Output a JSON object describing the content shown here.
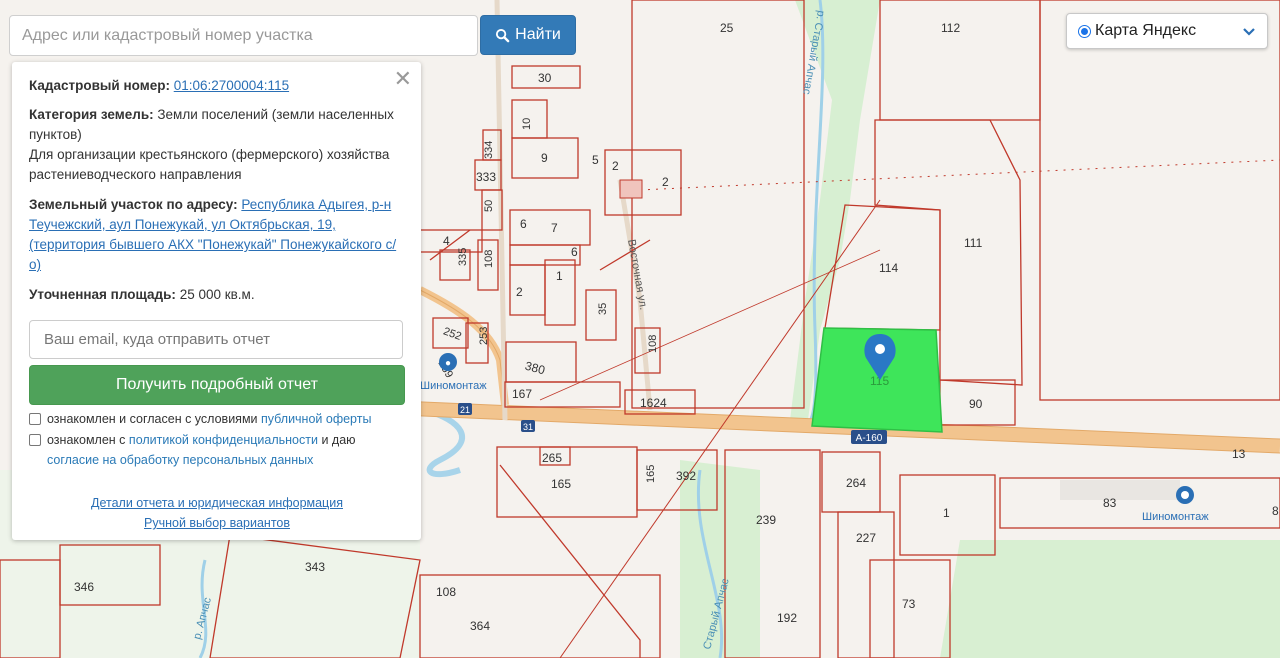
{
  "search": {
    "placeholder": "Адрес или кадастровый номер участка",
    "button_label": "Найти"
  },
  "map_type": {
    "selected": "Карта Яндекс"
  },
  "info": {
    "cadastral_label": "Кадастровый номер:",
    "cadastral_value": "01:06:2700004:115",
    "category_label": "Категория земель:",
    "category_value": "Земли поселений (земли населенных пунктов)",
    "usage_value": "Для организации крестьянского (фермерского) хозяйства растениеводческого направления",
    "address_label": "Земельный участок по адресу:",
    "address_value": "Республика Адыгея, р-н Теучежский, аул Понежукай, ул Октябрьская, 19, (территория бывшего АКХ \"Понежукай\" Понежукайского с/о)",
    "area_label": "Уточненная площадь:",
    "area_value": "25 000 кв.м.",
    "email_placeholder": "Ваш email, куда отправить отчет",
    "get_report_button": "Получить подробный отчет",
    "consent1_text": "ознакомлен и согласен с условиями",
    "consent1_link": "публичной оферты",
    "consent2_text": "ознакомлен с",
    "consent2_link": "политикой конфиденциальности",
    "consent2_text2": "и даю",
    "consent2_link2": "согласие на обработку персональных данных",
    "details_link": "Детали отчета и юридическая информация",
    "manual_link": "Ручной выбор вариантов"
  },
  "map": {
    "road_label": "А-160",
    "route_31": "31",
    "route_21": "21",
    "poi_tire_left": "Шиномонтаж",
    "poi_tire_right": "Шиномонтаж",
    "street_vostochnaya": "Восточная ул.",
    "river_old": "р. Старый Апчас",
    "river_right": "Старый Апчас",
    "river_left": "р. Апчас",
    "parcel_numbers": [
      "25",
      "112",
      "30",
      "10",
      "9",
      "5",
      "2",
      "2",
      "334",
      "333",
      "50",
      "108",
      "4",
      "6",
      "7",
      "6",
      "335",
      "1",
      "35",
      "2",
      "252",
      "253",
      "259",
      "108",
      "380",
      "167",
      "1624",
      "114",
      "111",
      "115",
      "90",
      "13",
      "265",
      "165",
      "165",
      "392",
      "264",
      "83",
      "8",
      "239",
      "227",
      "1",
      "346",
      "343",
      "108",
      "364",
      "192",
      "73"
    ],
    "colors": {
      "highlight_parcel": "#3ee55a",
      "parcel_line": "#c0392b",
      "road": "#f2c48e",
      "green": "#d6efd0",
      "marker": "#2a78c5"
    }
  }
}
